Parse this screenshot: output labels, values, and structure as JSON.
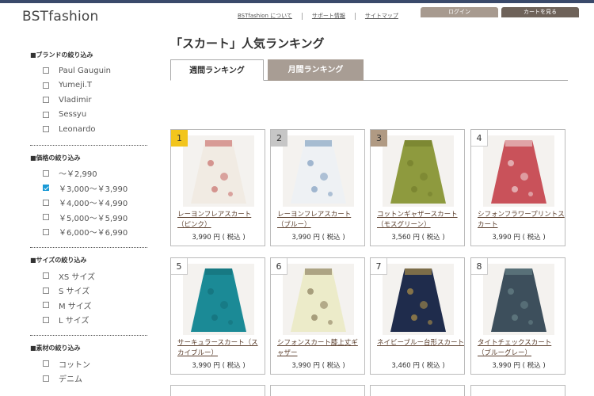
{
  "brand": "BSTfashion",
  "header": {
    "links": [
      "BSTfashion について",
      "サポート情報",
      "サイトマップ"
    ],
    "login": "ログイン",
    "cart": "カートを見る"
  },
  "sidebar": {
    "brand_filter": {
      "title": "■ブランドの絞り込み",
      "items": [
        "Paul Gauguin",
        "Yumeji.T",
        "Vladimir",
        "Sessyu",
        "Leonardo"
      ]
    },
    "price_filter": {
      "title": "■価格の絞り込み",
      "items": [
        "～￥2,990",
        "￥3,000～￥3,990",
        "￥4,000～￥4,990",
        "￥5,000～￥5,990",
        "￥6,000～￥6,990"
      ],
      "checked_index": 1
    },
    "size_filter": {
      "title": "■サイズの絞り込み",
      "items": [
        "XS サイズ",
        "S サイズ",
        "M サイズ",
        "L サイズ"
      ]
    },
    "material_filter": {
      "title": "■素材の絞り込み",
      "items": [
        "コットン",
        "デニム"
      ]
    }
  },
  "main": {
    "title": "「スカート」人気ランキング",
    "tabs": [
      "週間ランキング",
      "月間ランキング"
    ],
    "active_tab": 0,
    "products": [
      {
        "rank": "1",
        "name": "レーヨンフレアスカート（ピンク）",
        "price": "3,990 円 ( 税込 )",
        "color": "#f1ebe3",
        "accent": "#c25a57"
      },
      {
        "rank": "2",
        "name": "レーヨンフレアスカート（ブルー）",
        "price": "3,990 円 ( 税込 )",
        "color": "#eef1f4",
        "accent": "#6c8fb5"
      },
      {
        "rank": "3",
        "name": "コットンギャザースカート（モスグリーン）",
        "price": "3,560 円 ( 税込 )",
        "color": "#8e9a3e",
        "accent": "#6f7a2a"
      },
      {
        "rank": "4",
        "name": "シフォンフラワープリントスカート",
        "price": "3,990 円 ( 税込 )",
        "color": "#c9525a",
        "accent": "#f3e6e6"
      },
      {
        "rank": "5",
        "name": "サーキュラースカート（スカイブルー）",
        "price": "3,990 円 ( 税込 )",
        "color": "#1b8a96",
        "accent": "#146b75"
      },
      {
        "rank": "6",
        "name": "シフォンスカート膝上丈ギャザー",
        "price": "3,990 円 ( 税込 )",
        "color": "#ecebc9",
        "accent": "#7a6a4a"
      },
      {
        "rank": "7",
        "name": "ネイビーブルー台形スカート",
        "price": "3,460 円 ( 税込 )",
        "color": "#1f2c4c",
        "accent": "#c9a447"
      },
      {
        "rank": "8",
        "name": "タイトチェックスカート（ブルーグレー）",
        "price": "3,990 円 ( 税込 )",
        "color": "#3d4f5c",
        "accent": "#6f8c8f"
      }
    ]
  }
}
